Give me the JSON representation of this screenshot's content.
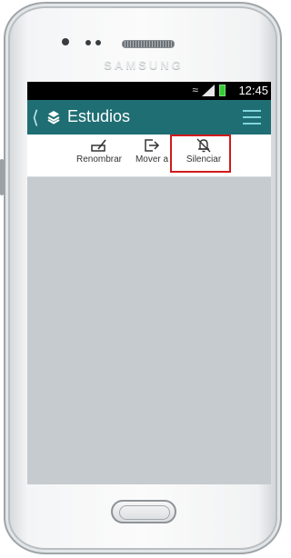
{
  "device": {
    "brand": "SAMSUNG"
  },
  "status_bar": {
    "time": "12:45",
    "icons": [
      "wifi-icon",
      "signal-icon",
      "battery-icon"
    ]
  },
  "app_bar": {
    "title": "Estudios",
    "back_icon": "chevron-left-icon",
    "folder_icon": "layers-icon",
    "menu_icon": "hamburger-menu-icon",
    "color": "#1f6e73"
  },
  "toolbar": {
    "actions": [
      {
        "label": "Renombrar",
        "icon": "rename-icon"
      },
      {
        "label": "Mover a",
        "icon": "move-to-icon"
      },
      {
        "label": "Silenciar",
        "icon": "bell-off-icon"
      }
    ],
    "highlight_color": "#d11a1a"
  }
}
